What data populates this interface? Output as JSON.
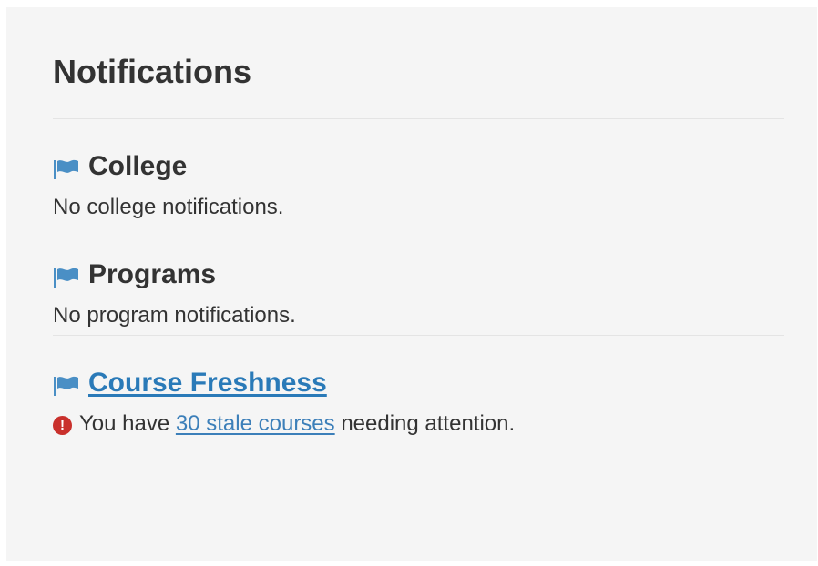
{
  "panel": {
    "title": "Notifications"
  },
  "sections": [
    {
      "icon": "flag-icon",
      "heading": "College",
      "heading_is_link": false,
      "text": "No college notifications."
    },
    {
      "icon": "flag-icon",
      "heading": "Programs",
      "heading_is_link": false,
      "text": "No program notifications."
    },
    {
      "icon": "flag-icon",
      "heading": "Course Freshness",
      "heading_is_link": true,
      "alert_icon": "exclamation-circle-icon",
      "alert_glyph": "!",
      "text_before": "You have",
      "link_text": "30 stale courses",
      "text_after": "needing attention."
    }
  ],
  "colors": {
    "panel_background": "#f5f5f5",
    "text": "#333333",
    "flag": "#4a8fc5",
    "link": "#2a7ab8",
    "alert": "#c9302c",
    "divider": "#e4e4e4"
  }
}
